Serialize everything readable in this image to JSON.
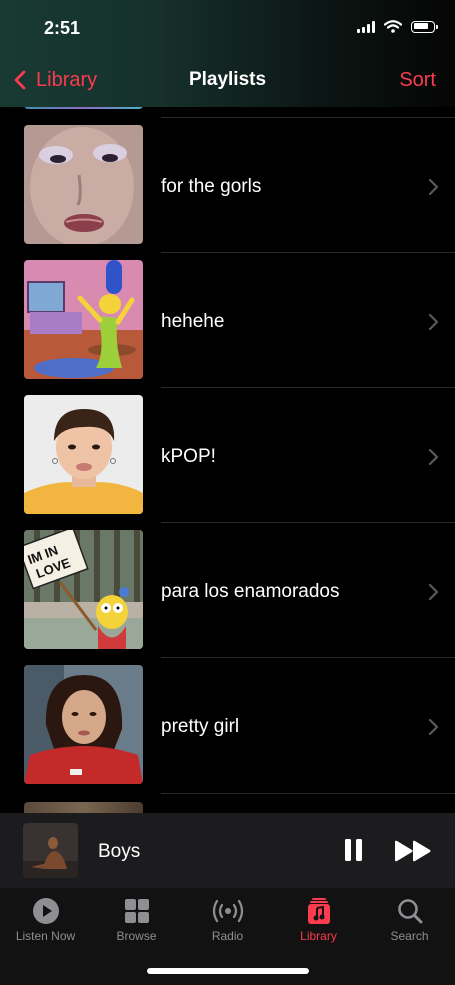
{
  "status": {
    "time": "2:51"
  },
  "nav": {
    "back_label": "Library",
    "title": "Playlists",
    "sort_label": "Sort"
  },
  "playlists": [
    {
      "title": "for the gorls"
    },
    {
      "title": "hehehe"
    },
    {
      "title": "kPOP!"
    },
    {
      "title": "para los enamorados",
      "sign_text": "IM IN LOVE"
    },
    {
      "title": "pretty girl"
    }
  ],
  "now_playing": {
    "title": "Boys"
  },
  "tabs": [
    {
      "label": "Listen Now",
      "icon": "play-circle-icon"
    },
    {
      "label": "Browse",
      "icon": "grid-icon"
    },
    {
      "label": "Radio",
      "icon": "radio-waves-icon"
    },
    {
      "label": "Library",
      "icon": "music-note-library-icon",
      "active": true
    },
    {
      "label": "Search",
      "icon": "magnifier-icon"
    }
  ],
  "colors": {
    "accent": "#fb3b4e",
    "background": "#000000",
    "inactive": "#8e8e93"
  }
}
